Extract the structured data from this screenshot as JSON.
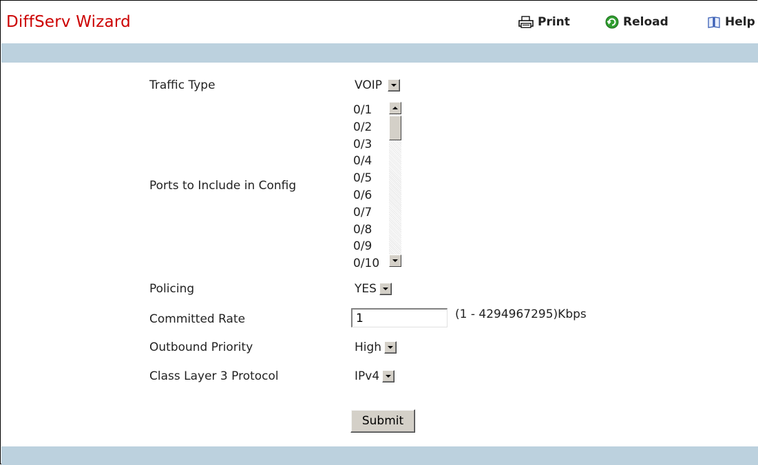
{
  "header": {
    "title": "DiffServ Wizard",
    "print_label": "Print",
    "reload_label": "Reload",
    "help_label": "Help",
    "title_color": "#cc0000",
    "band_color": "#bcd1de"
  },
  "form": {
    "traffic_type": {
      "label": "Traffic Type",
      "value": "VOIP"
    },
    "ports": {
      "label": "Ports to Include in Config",
      "options": [
        "0/1",
        "0/2",
        "0/3",
        "0/4",
        "0/5",
        "0/6",
        "0/7",
        "0/8",
        "0/9",
        "0/10"
      ]
    },
    "policing": {
      "label": "Policing",
      "value": "YES"
    },
    "committed_rate": {
      "label": "Committed Rate",
      "value": "1",
      "range_hint": "(1 - 4294967295)Kbps"
    },
    "outbound_priority": {
      "label": "Outbound Priority",
      "value": "High"
    },
    "class_l3_protocol": {
      "label": "Class Layer 3 Protocol",
      "value": "IPv4"
    },
    "submit_label": "Submit"
  }
}
